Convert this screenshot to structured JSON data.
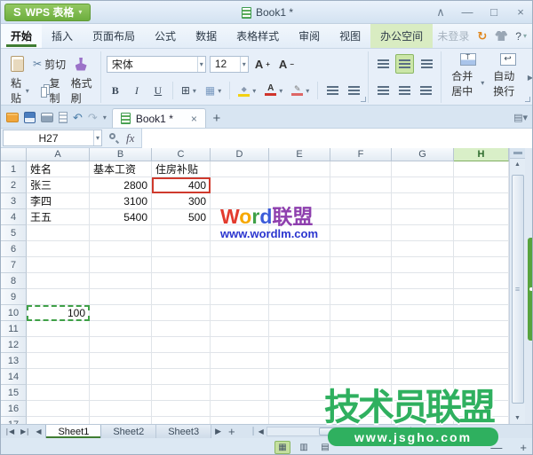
{
  "titlebar": {
    "logo_text": "WPS 表格",
    "doc_title": "Book1 *"
  },
  "icons": {
    "logo_glyph": "S",
    "caret": "▾",
    "collapse": "∧",
    "minimize": "—",
    "maximize": "□",
    "close": "×",
    "undo": "↶",
    "redo": "↷",
    "scissors": "✂",
    "border_grid": "⊞",
    "table_style": "▦",
    "wrap_arrow": "↩",
    "merge_t": "T",
    "font_a": "A",
    "plus_sup": "+",
    "minus_sup": "−",
    "first_sheet": "∣◀",
    "last_sheet": "▶∣",
    "prev": "◀",
    "next": "▶",
    "add": "+",
    "up": "▲",
    "down": "▼",
    "grip": "≡",
    "view_normal": "▦",
    "view_layout": "▥",
    "view_break": "▤",
    "zoom_out": "—",
    "zoom_in": "+",
    "more": "▶",
    "help": "?",
    "promo": "↻",
    "doc_close": "×",
    "toolbar_more": "▤▾"
  },
  "menu": {
    "tabs": [
      "开始",
      "插入",
      "页面布局",
      "公式",
      "数据",
      "表格样式",
      "审阅",
      "视图",
      "办公空间"
    ],
    "active_index": 0,
    "green_index": 8,
    "login": "未登录"
  },
  "ribbon": {
    "paste": "粘贴",
    "cut": "剪切",
    "copy": "复制",
    "painter": "格式刷",
    "font_family": "宋体",
    "font_size": "12",
    "bold": "B",
    "italic": "I",
    "underline": "U",
    "merge": "合并居中",
    "wrap": "自动换行"
  },
  "doctab": {
    "title": "Book1 *"
  },
  "formula_bar": {
    "name_box": "H27",
    "fx": "fx"
  },
  "grid": {
    "columns": [
      "A",
      "B",
      "C",
      "D",
      "E",
      "F",
      "G",
      "H"
    ],
    "selected_column": "H",
    "row_count": 17,
    "cells": [
      {
        "r": 1,
        "c": "A",
        "v": "姓名",
        "a": "left"
      },
      {
        "r": 1,
        "c": "B",
        "v": "基本工资",
        "a": "left"
      },
      {
        "r": 1,
        "c": "C",
        "v": "住房补贴",
        "a": "left"
      },
      {
        "r": 2,
        "c": "A",
        "v": "张三",
        "a": "left"
      },
      {
        "r": 2,
        "c": "B",
        "v": "2800",
        "a": "right"
      },
      {
        "r": 2,
        "c": "C",
        "v": "400",
        "a": "right",
        "marker": "red-box"
      },
      {
        "r": 3,
        "c": "A",
        "v": "李四",
        "a": "left"
      },
      {
        "r": 3,
        "c": "B",
        "v": "3100",
        "a": "right"
      },
      {
        "r": 3,
        "c": "C",
        "v": "300",
        "a": "right"
      },
      {
        "r": 4,
        "c": "A",
        "v": "王五",
        "a": "left"
      },
      {
        "r": 4,
        "c": "B",
        "v": "5400",
        "a": "right"
      },
      {
        "r": 4,
        "c": "C",
        "v": "500",
        "a": "right"
      },
      {
        "r": 10,
        "c": "A",
        "v": "100",
        "a": "right",
        "marker": "copy-dashed"
      }
    ]
  },
  "sheets": {
    "tabs": [
      "Sheet1",
      "Sheet2",
      "Sheet3"
    ],
    "active": "Sheet1"
  },
  "watermarks": {
    "wordlm_letters": [
      {
        "t": "W",
        "color": "#e33b2e"
      },
      {
        "t": "o",
        "color": "#f6a800"
      },
      {
        "t": "r",
        "color": "#3fa047"
      },
      {
        "t": "d",
        "color": "#3b5bd9"
      },
      {
        "t": "联盟",
        "color": "#8e3fae"
      }
    ],
    "wordlm_url": "www.wordlm.com",
    "jsgho_text": "技术员联盟",
    "jsgho_url": "www.jsgho.com"
  }
}
